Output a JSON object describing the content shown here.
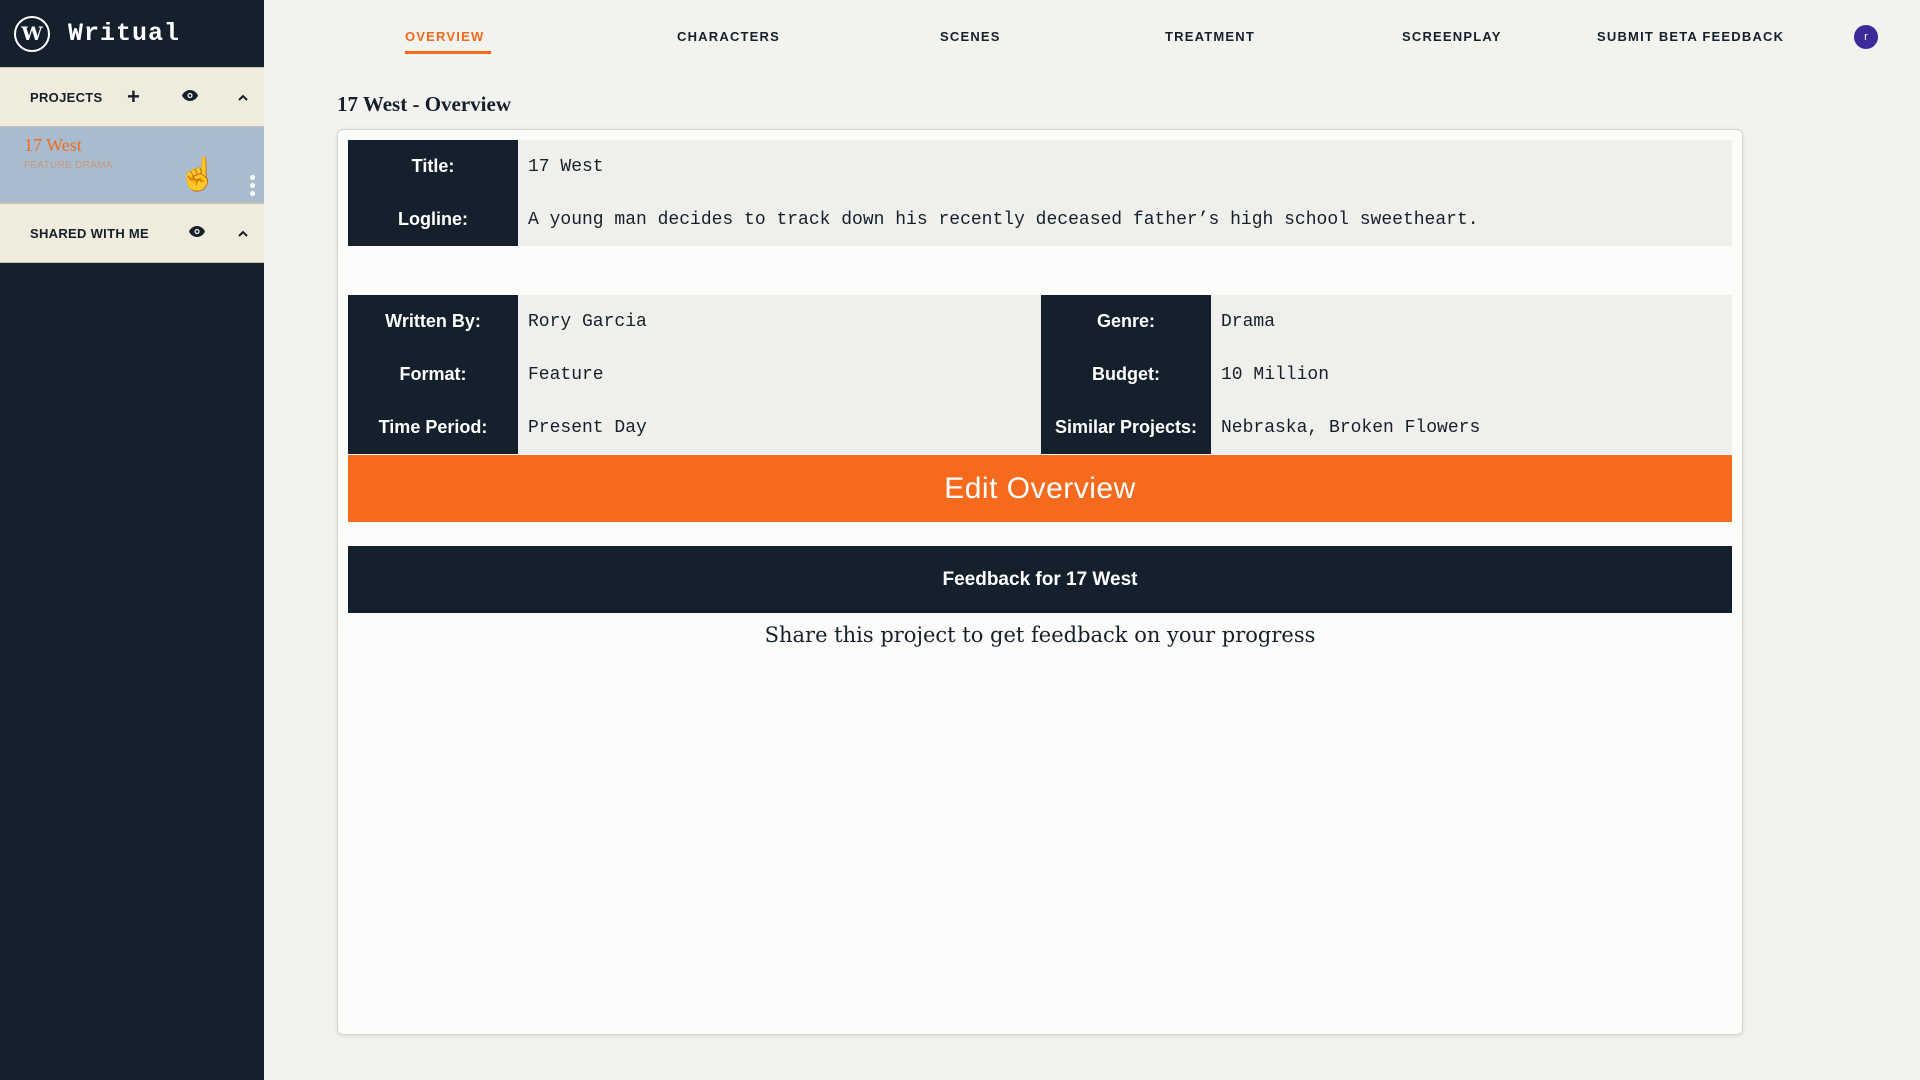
{
  "brand": {
    "logo_letter": "W",
    "name": "Writual"
  },
  "sidebar": {
    "projects_header": "PROJECTS",
    "projects": [
      {
        "name": "17 West",
        "subtitle": "FEATURE DRAMA"
      }
    ],
    "shared_header": "SHARED WITH ME"
  },
  "nav": {
    "tabs": [
      "OVERVIEW",
      "CHARACTERS",
      "SCENES",
      "TREATMENT",
      "SCREENPLAY",
      "SUBMIT BETA FEEDBACK"
    ],
    "active_tab": "OVERVIEW",
    "avatar_initial": "r"
  },
  "page": {
    "title": "17 West - Overview"
  },
  "overview": {
    "title_label": "Title:",
    "title_value": "17 West",
    "logline_label": "Logline:",
    "logline_value": "A young man decides to track down his recently deceased father’s high school sweetheart.",
    "written_by_label": "Written By:",
    "written_by_value": "Rory Garcia",
    "format_label": "Format:",
    "format_value": "Feature",
    "time_period_label": "Time Period:",
    "time_period_value": "Present Day",
    "genre_label": "Genre:",
    "genre_value": "Drama",
    "budget_label": "Budget:",
    "budget_value": "10 Million",
    "similar_label": "Similar Projects:",
    "similar_value": "Nebraska, Broken Flowers"
  },
  "edit_button": "Edit Overview",
  "feedback": {
    "header": "Feedback for 17 West",
    "message": "Share this project to get feedback on your progress"
  },
  "colors": {
    "navy": "#14202c",
    "orange": "#f26a1b",
    "cream": "#efebdd",
    "selected_project": "#a9bccf",
    "avatar": "#3a2a9a"
  }
}
